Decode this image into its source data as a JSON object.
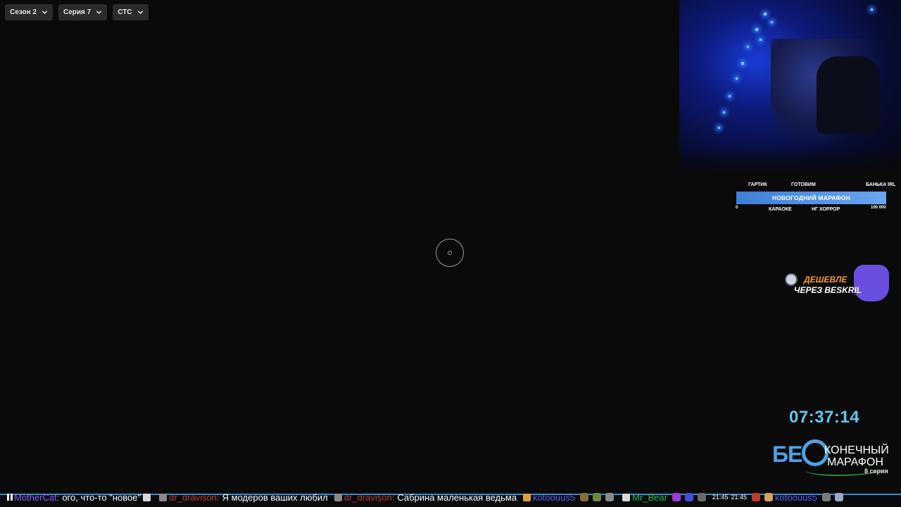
{
  "selectors": {
    "season": "Сезон 2",
    "episode": "Серия 7",
    "channel": "СТС"
  },
  "goals": {
    "top_labels": [
      "ГАРТИК",
      "ГОТОВИМ",
      "БАНЬКА IRL"
    ],
    "bottom_labels": [
      "КАРАОКЕ",
      "НГ ХОРРОР"
    ],
    "bar_label": "НОВОГОДНИЙ МАРАФОН",
    "min": "0",
    "max": "100 000"
  },
  "sponsor": {
    "line1": "ДЕШЕВЛЕ",
    "line2": "ЧЕРЕЗ BESKRIL"
  },
  "timer": "07:37:14",
  "logo": {
    "prefix": "БЕ",
    "word1": "КОНЕЧНЫЙ",
    "word2": "МАРАФОН",
    "sub": "8 серия"
  },
  "chat": {
    "messages": [
      {
        "user": "MotherCat:",
        "text": "ого, что-то \"новое\"",
        "user_color": "#9b59ff"
      },
      {
        "user": "dr_dravison:",
        "text": "Я модеров ваших любил",
        "user_color": "#c0392b"
      },
      {
        "user": "dr_dravison:",
        "text": "Сабрина маленькая ведьма",
        "user_color": "#c0392b"
      },
      {
        "user": "kotoouus5",
        "text": "",
        "user_color": "#5b5bff"
      },
      {
        "user": "Mr_Bear",
        "text": "",
        "user_color": "#1fbf4a"
      }
    ],
    "times": [
      "21:45",
      "21:45"
    ],
    "trailing_user": "kotoouus5"
  },
  "colors": {
    "background": "#0a0a0a",
    "accent_blue": "#5fc8ee",
    "progress_bar": "#3c7fd8"
  }
}
